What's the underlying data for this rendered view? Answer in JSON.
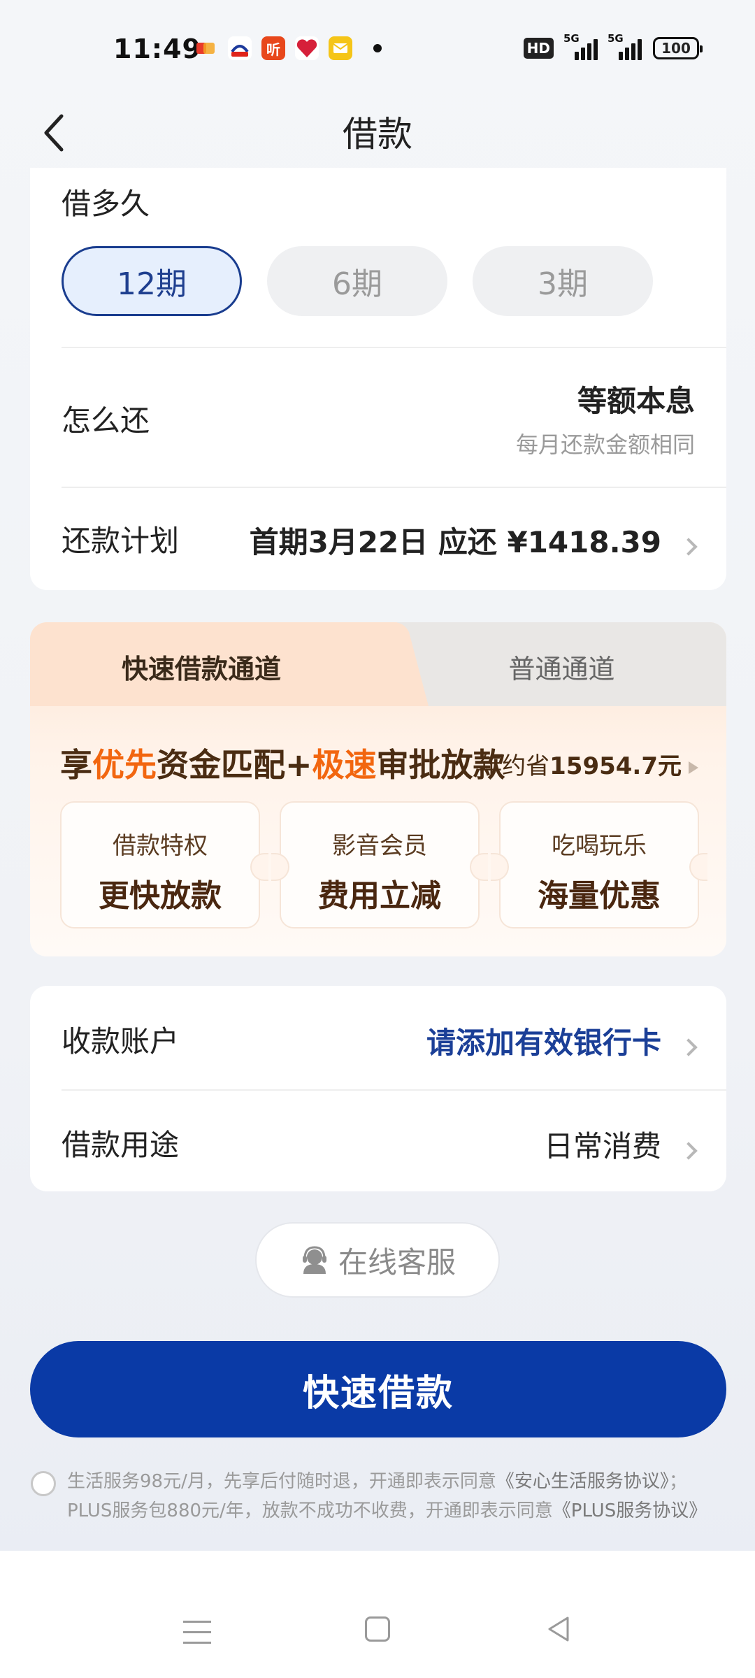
{
  "status_bar": {
    "time": "11:49",
    "notification_icons": [
      "photos-icon",
      "jd-icon",
      "listen-icon",
      "heart-app-icon",
      "mail-icon"
    ],
    "listen_glyph": "听",
    "hd_label": "HD",
    "signal1_label": "5G",
    "signal2_label": "5G",
    "battery": "100"
  },
  "header": {
    "title": "借款"
  },
  "term": {
    "label": "借多久",
    "options": [
      "12期",
      "6期",
      "3期"
    ],
    "selected": "12期"
  },
  "repayment": {
    "label": "怎么还",
    "method": "等额本息",
    "method_desc": "每月还款金额相同"
  },
  "plan": {
    "label": "还款计划",
    "value": "首期3月22日 应还 ¥1418.39"
  },
  "channel": {
    "tab_fast": "快速借款通道",
    "tab_normal": "普通通道",
    "promo": {
      "p1": "享",
      "p2": "优先",
      "p3": "资金匹配+",
      "p4": "极速",
      "p5": "审批放款"
    },
    "saving_prefix": "年约省",
    "saving_amount": "15954.7元",
    "benefits": [
      {
        "title": "借款特权",
        "value": "更快放款"
      },
      {
        "title": "影音会员",
        "value": "费用立减"
      },
      {
        "title": "吃喝玩乐",
        "value": "海量优惠"
      }
    ]
  },
  "account": {
    "label": "收款账户",
    "value": "请添加有效银行卡"
  },
  "purpose": {
    "label": "借款用途",
    "value": "日常消费"
  },
  "service_button": "在线客服",
  "main_button": "快速借款",
  "agreement": {
    "line1": "生活服务98元/月，先享后付随时退，开通即表示同意",
    "link1": "《安心生活服务协议》",
    "line1_end": "；",
    "line2": "PLUS服务包880元/年，放款不成功不收费，开通即表示同意",
    "link2": "《PLUS服务协议》"
  },
  "colors": {
    "primary": "#0a3aa6",
    "accent_orange": "#f2660f",
    "link_blue": "#1b3f97"
  }
}
